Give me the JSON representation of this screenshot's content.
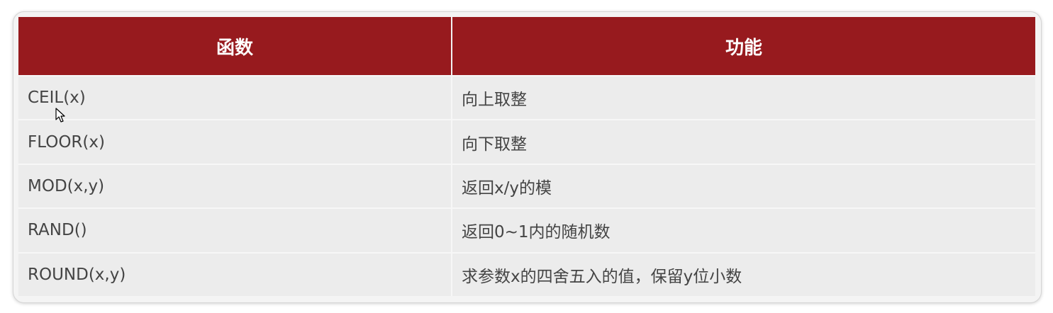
{
  "table": {
    "headers": [
      "函数",
      "功能"
    ],
    "rows": [
      {
        "function": "CEIL(x)",
        "description": "向上取整"
      },
      {
        "function": "FLOOR(x)",
        "description": "向下取整"
      },
      {
        "function": "MOD(x,y)",
        "description": "返回x/y的模"
      },
      {
        "function": "RAND()",
        "description": "返回0~1内的随机数"
      },
      {
        "function": "ROUND(x,y)",
        "description": "求参数x的四舍五入的值，保留y位小数"
      }
    ]
  },
  "colors": {
    "header_bg": "#971a1e",
    "header_text": "#ffffff",
    "cell_bg": "#ececec",
    "cell_text": "#444444"
  },
  "icons": {
    "cursor": "mouse-pointer-icon"
  }
}
